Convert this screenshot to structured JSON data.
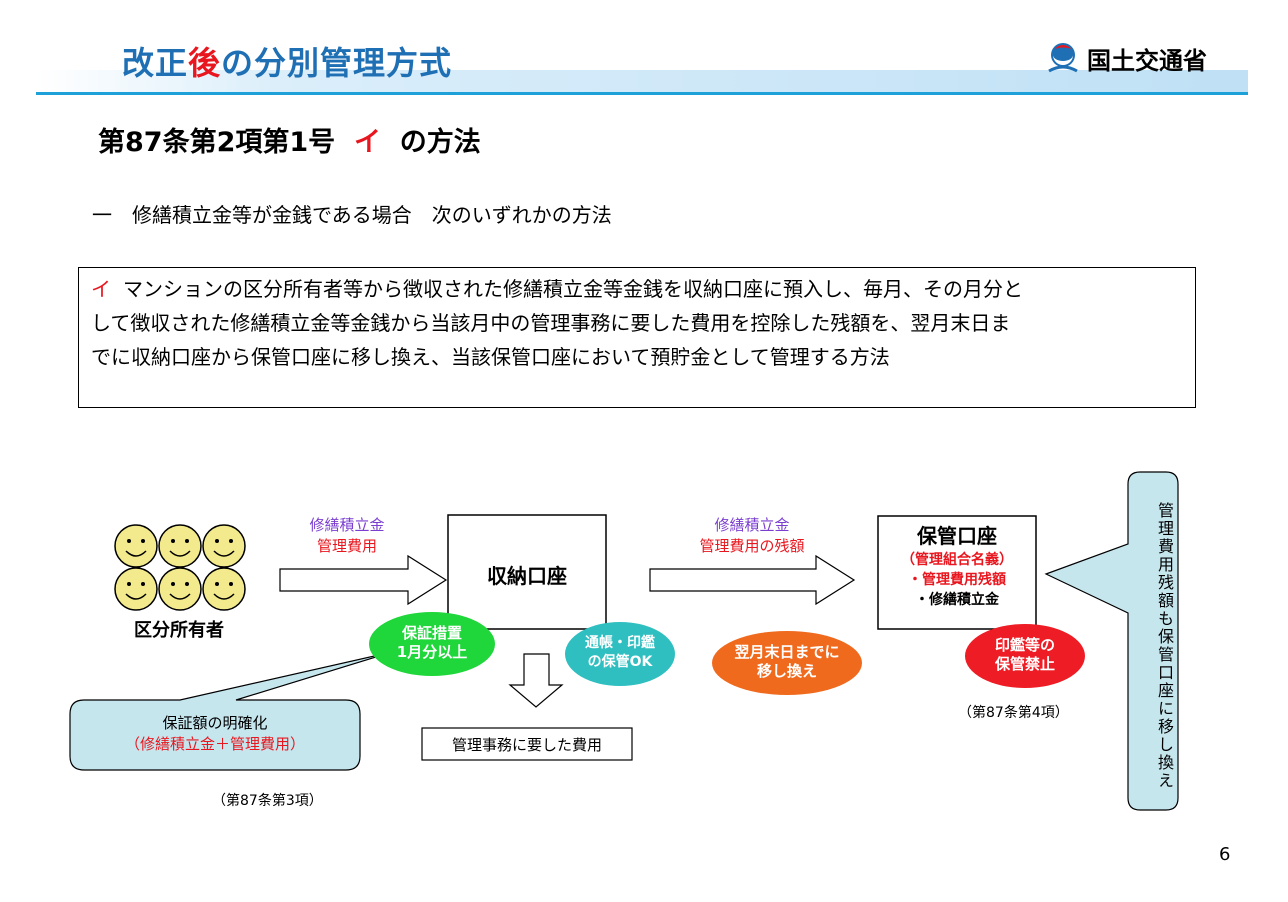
{
  "header": {
    "title_pre": "改正",
    "title_accent": "後",
    "title_post": "の分別管理方式",
    "logo_text": "国土交通省"
  },
  "section": {
    "title_pre": "第87条第2項第1号",
    "title_accent": "イ",
    "title_post": "の方法"
  },
  "intro": "一　修繕積立金等が金銭である場合　次のいずれかの方法",
  "definition": {
    "marker": "イ",
    "line1": "マンションの区分所有者等から徴収された修繕積立金等金銭を収納口座に預入し、毎月、その月分と",
    "line2": "して徴収された修繕積立金等金銭から当該月中の管理事務に要した費用を控除した残額を、翌月末日ま",
    "line3": "でに収納口座から保管口座に移し換え、当該保管口座において預貯金として管理する方法"
  },
  "diagram": {
    "owners_label": "区分所有者",
    "arrow1": {
      "line1": "修繕積立金",
      "line2": "管理費用"
    },
    "collection_account": "収納口座",
    "arrow2": {
      "line1": "修繕積立金",
      "line2": "管理費用の残額"
    },
    "custody_account": {
      "title": "保管口座",
      "subtitle": "（管理組合名義）",
      "item1": "・管理費用残額",
      "item2": "・修繕積立金"
    },
    "oval_guarantee": {
      "line1": "保証措置",
      "line2": "1月分以上"
    },
    "oval_passbook": {
      "line1": "通帳・印鑑",
      "line2": "の保管OK"
    },
    "oval_transfer": {
      "line1": "翌月末日までに",
      "line2": "移し換え"
    },
    "oval_seal": {
      "line1": "印鑑等の",
      "line2": "保管禁止"
    },
    "callout_guarantee": {
      "line1": "保証額の明確化",
      "line2": "（修繕積立金＋管理費用）"
    },
    "cite_3": "（第87条第3項）",
    "cite_4": "（第87条第4項）",
    "expense_box": "管理事務に要した費用",
    "vertical_callout": "管理費用残額も保管口座に移し換え",
    "colors": {
      "green": "#1fd63b",
      "teal": "#2fbfc0",
      "orange": "#f06a1e",
      "red": "#ee1c24",
      "callout_fill": "#c6e6ee",
      "face_fill": "#f2ea8c"
    }
  },
  "page_number": "6"
}
